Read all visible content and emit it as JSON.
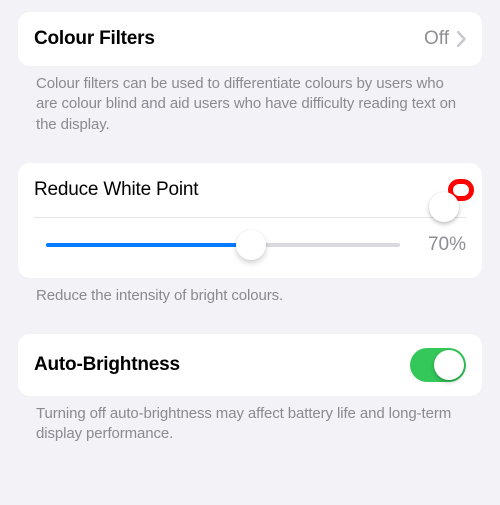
{
  "colour_filters": {
    "title": "Colour Filters",
    "value": "Off",
    "caption": "Colour filters can be used to differentiate colours by users who are colour blind and aid users who have difficulty reading text on the display."
  },
  "reduce_white_point": {
    "title": "Reduce White Point",
    "enabled": true,
    "slider_percent": 70,
    "slider_label": "70%",
    "slider_fill_pct": "58%",
    "caption": "Reduce the intensity of bright colours."
  },
  "auto_brightness": {
    "title": "Auto-Brightness",
    "enabled": true,
    "caption": "Turning off auto-brightness may affect battery life and long-term display performance."
  },
  "colors": {
    "toggle_on": "#34c759",
    "accent_blue": "#007aff",
    "highlight": "#ff0000"
  }
}
